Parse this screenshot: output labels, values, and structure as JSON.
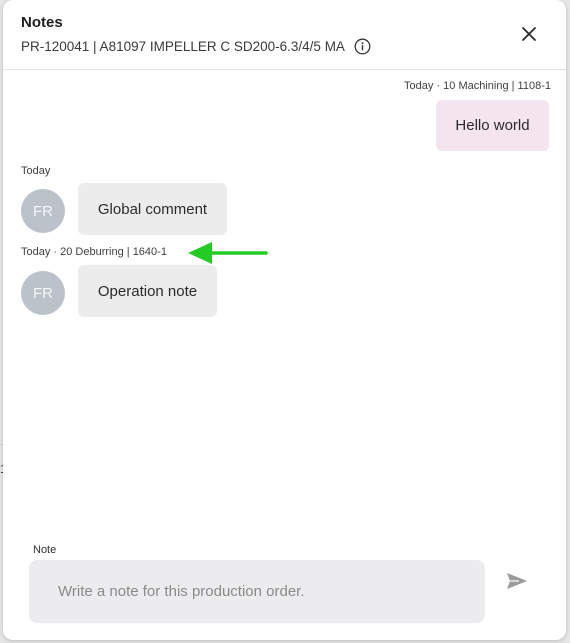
{
  "dialog": {
    "title": "Notes",
    "subtitle": "PR-120041 | A81097 IMPELLER C SD200-6.3/4/5 MA",
    "info_icon": "info-circle-icon",
    "close_icon": "close-icon"
  },
  "messages": [
    {
      "meta": "Today · 10 Machining | 1108-1",
      "text": "Hello world",
      "direction": "outgoing"
    },
    {
      "meta": "Today",
      "avatar": "FR",
      "text": "Global comment",
      "direction": "incoming"
    },
    {
      "meta": "Today · 20 Deburring | 1640-1",
      "avatar": "FR",
      "text": "Operation note",
      "direction": "incoming"
    }
  ],
  "annotation": {
    "arrow_icon": "green-arrow-left-icon",
    "color": "#22cc22"
  },
  "composer": {
    "label": "Note",
    "placeholder": "Write a note for this production order.",
    "value": "",
    "send_icon": "send-icon"
  },
  "colors": {
    "outgoing_bubble": "#f3e4ee",
    "incoming_bubble": "#ececec",
    "avatar": "#bcc2c9"
  },
  "background": {
    "partial_char": "1"
  }
}
